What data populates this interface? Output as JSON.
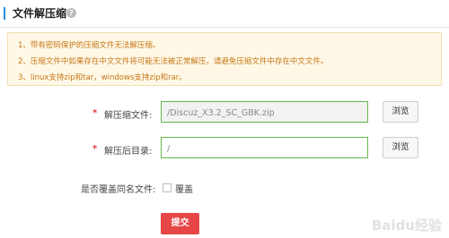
{
  "header": {
    "title": "文件解压缩",
    "help_icon": "?"
  },
  "notice": {
    "lines": [
      "1、带有密码保护的压缩文件无法解压缩。",
      "2、压缩文件中如果存在中文文件将可能无法被正常解压，请避免压缩文件中存在中文文件。",
      "3、linux支持zip和tar，windows支持zip和rar。"
    ]
  },
  "form": {
    "file": {
      "required_mark": "*",
      "label": "解压缩文件:",
      "value": "/Discuz_X3.2_SC_GBK.zip",
      "browse_label": "浏览"
    },
    "dir": {
      "required_mark": "*",
      "label": "解压后目录:",
      "value": "/",
      "browse_label": "浏览"
    },
    "overwrite": {
      "label": "是否覆盖同名文件:",
      "checkbox_label": "覆盖",
      "checked": false
    },
    "submit_label": "提交"
  },
  "watermark": "Baidu经验"
}
